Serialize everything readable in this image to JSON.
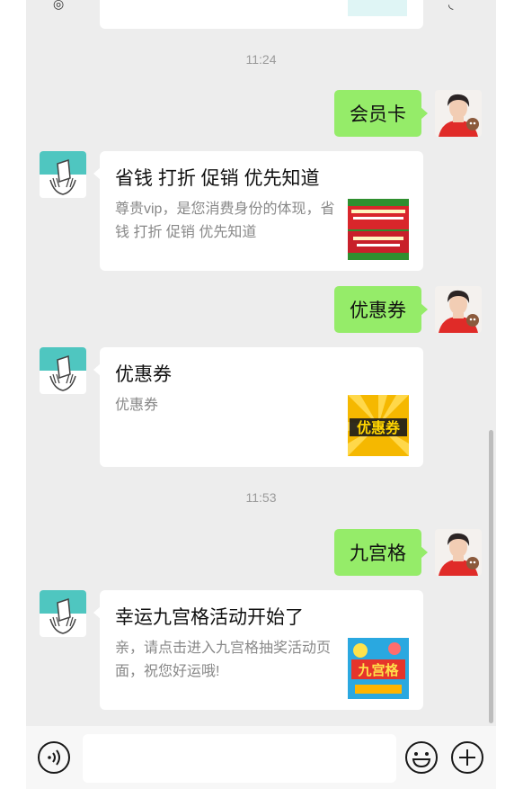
{
  "previous": {
    "thumb_color": "#dff5f5"
  },
  "messages": [
    {
      "type": "timestamp",
      "time": "11:24"
    },
    {
      "type": "sent",
      "text": "会员卡"
    },
    {
      "type": "card",
      "title": "省钱 打折 促销 优先知道",
      "desc": "尊贵vip，是您消费身份的体现，省钱 打折 促销 优先知道",
      "thumb": "vip-banner"
    },
    {
      "type": "sent",
      "text": "优惠券"
    },
    {
      "type": "card",
      "title": "优惠券",
      "desc": "优惠券",
      "thumb": "coupon-logo",
      "thumb_text": "优惠券"
    },
    {
      "type": "timestamp",
      "time": "11:53"
    },
    {
      "type": "sent",
      "text": "九宫格"
    },
    {
      "type": "card",
      "title": "幸运九宫格活动开始了",
      "desc": "亲，请点击进入九宫格抽奖活动页面，祝您好运哦!",
      "thumb": "lottery-grid",
      "thumb_text": "九宫格"
    }
  ],
  "input_bar": {
    "voice_icon": "voice-icon",
    "emoji_icon": "emoji-icon",
    "plus_icon": "plus-icon",
    "placeholder": ""
  },
  "colors": {
    "chat_bg": "#ededed",
    "sent_bubble": "#95ec69",
    "timestamp": "#9a9a9a",
    "desc_text": "#888888"
  }
}
